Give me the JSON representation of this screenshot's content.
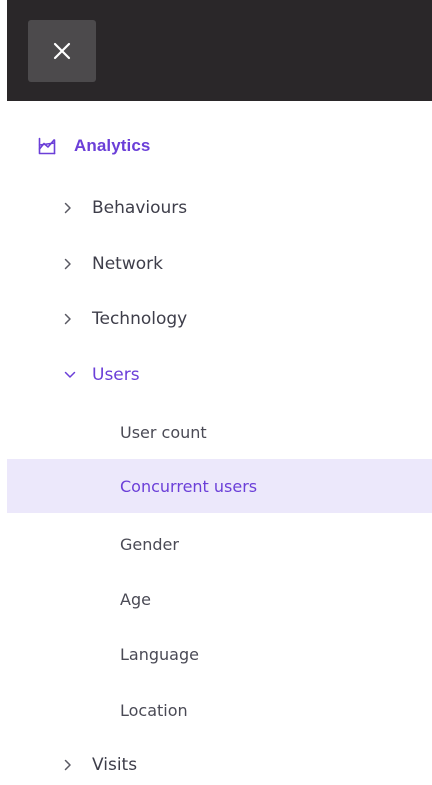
{
  "header": {
    "close_icon": "close-icon",
    "bg_color": "#2a2729"
  },
  "section": {
    "icon": "analytics-chart-icon",
    "label": "Analytics",
    "accent_color": "#6b3fd8"
  },
  "nav": {
    "behaviours": "Behaviours",
    "network": "Network",
    "technology": "Technology",
    "users": "Users",
    "visits": "Visits"
  },
  "users_sub": {
    "user_count": "User count",
    "concurrent_users": "Concurrent users",
    "gender": "Gender",
    "age": "Age",
    "language": "Language",
    "location": "Location"
  },
  "selected_item": "Concurrent users",
  "selected_bg": "#ece8fb"
}
